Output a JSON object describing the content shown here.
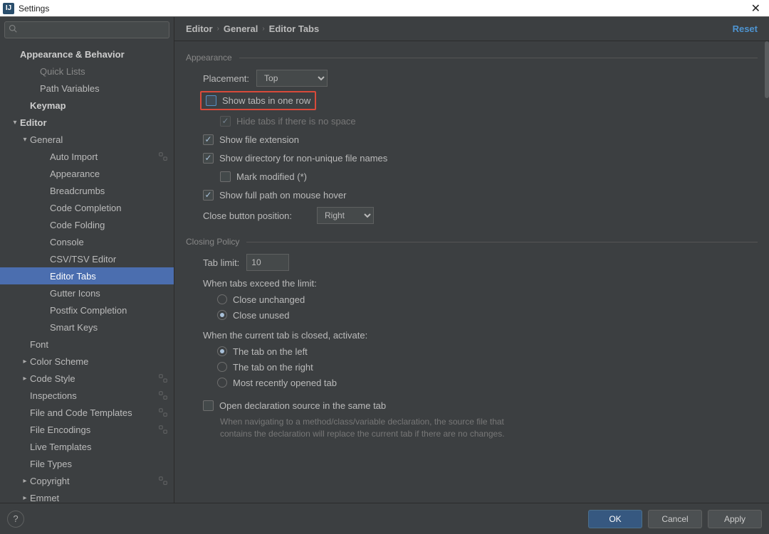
{
  "window": {
    "title": "Settings"
  },
  "actions": {
    "reset": "Reset",
    "ok": "OK",
    "cancel": "Cancel",
    "apply": "Apply",
    "help": "?",
    "close": "✕"
  },
  "search": {
    "placeholder": ""
  },
  "breadcrumb": [
    "Editor",
    "General",
    "Editor Tabs"
  ],
  "sidebar": {
    "items": [
      {
        "label": "Appearance & Behavior",
        "indent": 1,
        "bold": true,
        "chev": ""
      },
      {
        "label": "Quick Lists",
        "indent": 3,
        "dim": true
      },
      {
        "label": "Path Variables",
        "indent": 3
      },
      {
        "label": "Keymap",
        "indent": 2,
        "bold": true
      },
      {
        "label": "Editor",
        "indent": 1,
        "bold": true,
        "chev": "▾"
      },
      {
        "label": "General",
        "indent": 2,
        "chev": "▾"
      },
      {
        "label": "Auto Import",
        "indent": 4,
        "schema": true
      },
      {
        "label": "Appearance",
        "indent": 4
      },
      {
        "label": "Breadcrumbs",
        "indent": 4
      },
      {
        "label": "Code Completion",
        "indent": 4
      },
      {
        "label": "Code Folding",
        "indent": 4
      },
      {
        "label": "Console",
        "indent": 4
      },
      {
        "label": "CSV/TSV Editor",
        "indent": 4
      },
      {
        "label": "Editor Tabs",
        "indent": 4,
        "selected": true
      },
      {
        "label": "Gutter Icons",
        "indent": 4
      },
      {
        "label": "Postfix Completion",
        "indent": 4
      },
      {
        "label": "Smart Keys",
        "indent": 4
      },
      {
        "label": "Font",
        "indent": 2
      },
      {
        "label": "Color Scheme",
        "indent": 2,
        "chev": "▸"
      },
      {
        "label": "Code Style",
        "indent": 2,
        "chev": "▸",
        "schema": true
      },
      {
        "label": "Inspections",
        "indent": 2,
        "schema": true
      },
      {
        "label": "File and Code Templates",
        "indent": 2,
        "schema": true
      },
      {
        "label": "File Encodings",
        "indent": 2,
        "schema": true
      },
      {
        "label": "Live Templates",
        "indent": 2
      },
      {
        "label": "File Types",
        "indent": 2
      },
      {
        "label": "Copyright",
        "indent": 2,
        "chev": "▸",
        "schema": true
      },
      {
        "label": "Emmet",
        "indent": 2,
        "chev": "▸"
      }
    ]
  },
  "appearance": {
    "section": "Appearance",
    "placement_label": "Placement:",
    "placement_value": "Top",
    "one_row": "Show tabs in one row",
    "hide_tabs": "Hide tabs if there is no space",
    "show_ext": "Show file extension",
    "show_dir": "Show directory for non-unique file names",
    "mark_modified": "Mark modified (*)",
    "show_full_path": "Show full path on mouse hover",
    "close_pos_label": "Close button position:",
    "close_pos_value": "Right"
  },
  "closing": {
    "section": "Closing Policy",
    "tab_limit_label": "Tab limit:",
    "tab_limit_value": "10",
    "exceed_label": "When tabs exceed the limit:",
    "r_unchanged": "Close unchanged",
    "r_unused": "Close unused",
    "closed_label": "When the current tab is closed, activate:",
    "r_left": "The tab on the left",
    "r_right": "The tab on the right",
    "r_recent": "Most recently opened tab",
    "open_decl": "Open declaration source in the same tab",
    "open_decl_help": "When navigating to a method/class/variable declaration, the source file that contains the declaration will replace the current tab if there are no changes."
  }
}
